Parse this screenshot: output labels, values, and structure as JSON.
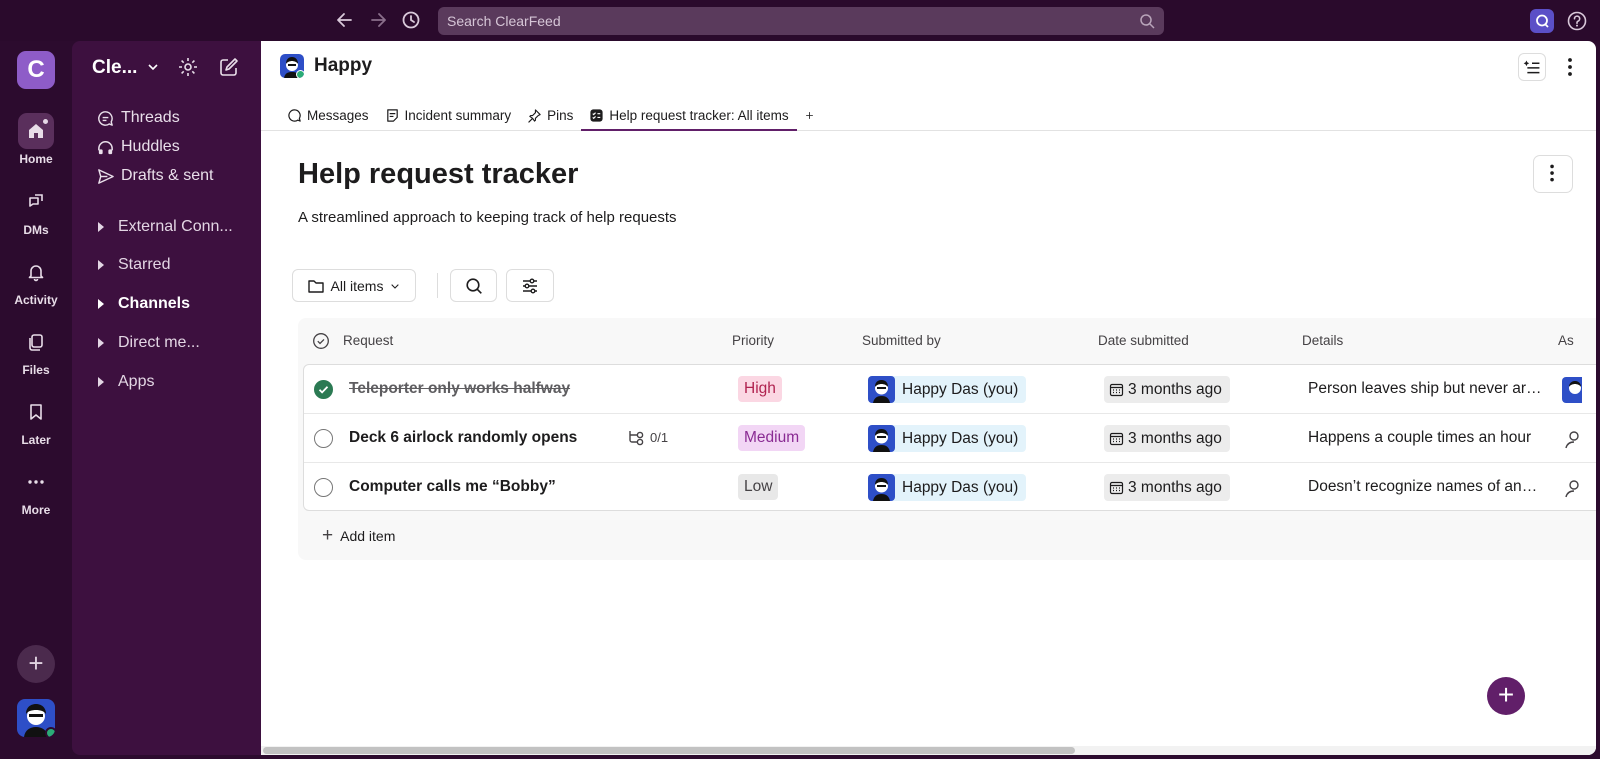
{
  "topbar": {
    "search_placeholder": "Search ClearFeed"
  },
  "rail": {
    "workspace_initial": "C",
    "items": [
      {
        "label": "Home"
      },
      {
        "label": "DMs"
      },
      {
        "label": "Activity"
      },
      {
        "label": "Files"
      },
      {
        "label": "Later"
      },
      {
        "label": "More"
      }
    ]
  },
  "sidebar": {
    "workspace_name": "Cle...",
    "items": [
      {
        "label": "Threads"
      },
      {
        "label": "Huddles"
      },
      {
        "label": "Drafts & sent"
      }
    ],
    "sections": [
      {
        "label": "External Conn..."
      },
      {
        "label": "Starred"
      },
      {
        "label": "Channels"
      },
      {
        "label": "Direct me..."
      },
      {
        "label": "Apps"
      }
    ]
  },
  "channel": {
    "title": "Happy",
    "tabs": [
      {
        "label": "Messages"
      },
      {
        "label": "Incident summary"
      },
      {
        "label": "Pins"
      },
      {
        "label": "Help request tracker: All items"
      }
    ]
  },
  "doc": {
    "title": "Help request tracker",
    "subtitle": "A streamlined approach to keeping track of help requests",
    "view_label": "All items"
  },
  "table": {
    "columns": [
      "Request",
      "Priority",
      "Submitted by",
      "Date submitted",
      "Details",
      "As"
    ],
    "rows": [
      {
        "request": "Teleporter only works halfway",
        "done": true,
        "subtasks": "",
        "priority": "High",
        "submitted_by": "Happy Das (you)",
        "date": "3 months ago",
        "details": "Person leaves ship but never arri..."
      },
      {
        "request": "Deck 6 airlock randomly opens",
        "done": false,
        "subtasks": "0/1",
        "priority": "Medium",
        "submitted_by": "Happy Das (you)",
        "date": "3 months ago",
        "details": "Happens a couple times an hour"
      },
      {
        "request": "Computer calls me “Bobby”",
        "done": false,
        "subtasks": "",
        "priority": "Low",
        "submitted_by": "Happy Das (you)",
        "date": "3 months ago",
        "details": "Doesn’t recognize names of any ..."
      }
    ],
    "add_item_label": "Add item"
  },
  "colors": {
    "aubergine": "#3d103f",
    "accent": "#611f69",
    "high": "#b0224f",
    "medium": "#8a2b93",
    "done_green": "#2b7a53"
  }
}
